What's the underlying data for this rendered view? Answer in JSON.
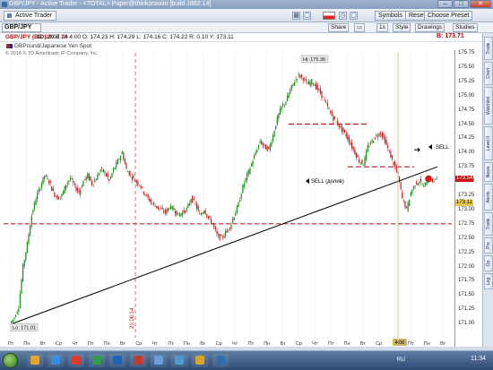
{
  "window": {
    "title": "GBP/JPY - Active Trader - <TOTAL> Paper@thinkorswim [build 1862.14]",
    "minimize": "–",
    "maximize": "□",
    "close": "✕"
  },
  "toolbar": {
    "active_tab": "Active Trader",
    "symbols": "Symbols",
    "reset": "Reset",
    "choose_preset": "Choose Preset"
  },
  "toolbar2": {
    "symbol": "GBP/JPY",
    "share": "Share",
    "period": "1s",
    "style": "Style",
    "drawings": "Drawings",
    "studies": "Studies"
  },
  "chart_header": {
    "symbol_label": "GBP/JPY (BID) 20 d 1h",
    "ohlc": "D: 10.07.14 4:00   O: 174.23   H: 174.29   L: 174.16   C: 174.22   R: 0.10   Y: 173.11",
    "bid_price": "B: 173.71",
    "description": "GBPound/Japanese Yen Spot",
    "copyright": "© 2014 © TD Ameritrade IP Company, Inc."
  },
  "chart_data": {
    "type": "line",
    "subtype": "candlestick (hourly)",
    "ylim": [
      170.75,
      175.75
    ],
    "y_ticks": [
      171,
      171.25,
      171.5,
      171.75,
      172,
      172.25,
      172.5,
      172.75,
      173,
      173.25,
      173.5,
      173.75,
      174,
      174.25,
      174.5,
      174.75,
      175,
      175.25,
      175.5,
      175.75
    ],
    "x_ticks": [
      "Пт",
      "Пн",
      "Вт",
      "Ср",
      "Чт",
      "Пт",
      "Пн",
      "Вт",
      "Ср",
      "Чт",
      "Пт",
      "Пн",
      "Вт",
      "Ср",
      "Чт",
      "Пт",
      "Пн",
      "Вт",
      "Ср",
      "Чт",
      "Пт",
      "Пн",
      "Вт",
      "Ср",
      "Чт",
      "Пт",
      "Пн",
      "Вт"
    ],
    "close_path": [
      171.01,
      171.1,
      171.3,
      172.0,
      172.4,
      172.9,
      173.2,
      173.4,
      173.6,
      173.5,
      173.3,
      173.2,
      173.25,
      173.45,
      173.55,
      173.4,
      173.3,
      173.5,
      173.6,
      173.45,
      173.55,
      173.7,
      173.65,
      173.5,
      173.7,
      173.85,
      174.0,
      173.7,
      173.6,
      173.5,
      173.45,
      173.3,
      173.2,
      173.1,
      173.05,
      173.0,
      172.95,
      173.05,
      173.0,
      172.9,
      172.95,
      173.0,
      173.2,
      173.1,
      172.9,
      173.0,
      172.85,
      172.75,
      172.55,
      172.5,
      172.6,
      172.7,
      172.9,
      173.1,
      173.4,
      173.6,
      173.8,
      174.0,
      174.2,
      174.1,
      174.05,
      174.3,
      174.6,
      174.8,
      174.9,
      175.1,
      175.25,
      175.36,
      175.3,
      175.2,
      175.25,
      175.15,
      175.05,
      174.9,
      174.75,
      174.6,
      174.5,
      174.4,
      174.3,
      174.15,
      174.0,
      173.85,
      173.8,
      174.1,
      174.2,
      174.3,
      174.35,
      174.2,
      174.0,
      173.8,
      173.6,
      173.2,
      173.0,
      173.3,
      173.45,
      173.5,
      173.4,
      173.55,
      173.5,
      173.54
    ],
    "annotations": {
      "high_label": "Hi: 175.36",
      "low_label": "Lo: 171.01",
      "sell_label": "SELL",
      "sell_add_label": "SELL (долив)",
      "vline_label": "20.06.14",
      "cursor_time_label": "4:00",
      "price_tag_red": "173.54",
      "price_tag_yellow": "173.11",
      "support_level": 172.75,
      "resistance_1": 174.5,
      "resistance_2": 173.75,
      "trendline_start": 171.0,
      "trendline_end": 173.75
    }
  },
  "sidebar": {
    "tabs": [
      "Trade",
      "Chart",
      "Watchlist",
      "Level II",
      "News",
      "Alerts",
      "Trade",
      "Pre",
      "Op",
      "Log"
    ]
  },
  "taskbar": {
    "lang": "RU",
    "clock": "11:34",
    "colors": [
      "#e5a52b",
      "#3a8de0",
      "#e23b2e",
      "#2f9e4b",
      "#1f63b8",
      "#c13c2f",
      "#6aa0d8",
      "#4b9cd3",
      "#d9a423",
      "#2f6fb0"
    ]
  }
}
